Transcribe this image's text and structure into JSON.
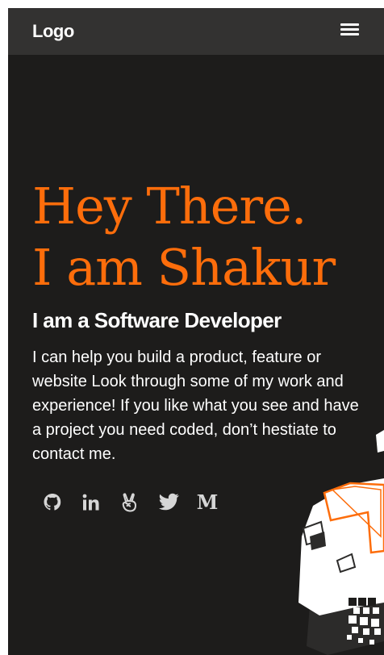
{
  "navbar": {
    "logo": "Logo",
    "menu_icon": "hamburger-menu-icon"
  },
  "hero": {
    "title_line1": "Hey There.",
    "title_line2": "I am Shakur",
    "subtitle": "I am a Software Developer",
    "description": "I can help you build a product, feature or website Look through some of my work and experience! If you like what you see and have a project you need coded, don’t hestiate to contact me."
  },
  "social_links": [
    {
      "icon": "github-icon"
    },
    {
      "icon": "linkedin-icon"
    },
    {
      "icon": "angellist-icon"
    },
    {
      "icon": "twitter-icon"
    },
    {
      "icon": "medium-icon",
      "glyph": "M"
    }
  ],
  "colors": {
    "accent": "#fd6d0b",
    "background": "#1d1c1b",
    "navbar": "#333231",
    "text": "#ffffff",
    "icon": "#d6d6d6"
  }
}
